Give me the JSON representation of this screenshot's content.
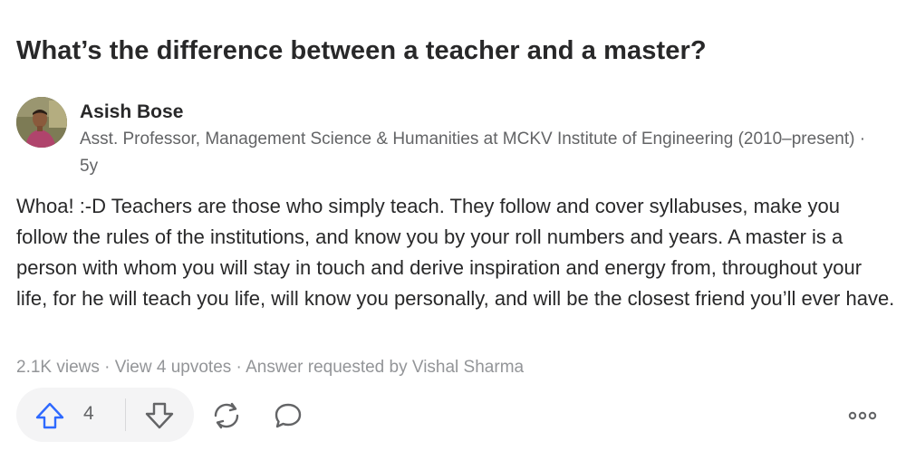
{
  "question": {
    "title": "What’s the difference between a teacher and a master?"
  },
  "author": {
    "name": "Asish Bose",
    "credential": "Asst. Professor, Management Science & Humanities at MCKV Institute of Engineering (2010–present) · 5y"
  },
  "answer": {
    "text": "Whoa! :-D Teachers are those who simply teach. They follow and cover syllabuses, make you follow the rules of the institutions, and know you by your roll numbers and years. A master is a person with whom you will stay in touch and derive inspiration and energy from, throughout your life, for he will teach you life, will know you personally, and will be the closest friend you’ll ever have.",
    "stats": "2.1K views · View 4 upvotes · Answer requested by Vishal Sharma"
  },
  "actions": {
    "upvote_count": "4",
    "upvote_icon": "arrow-up-icon",
    "downvote_icon": "arrow-down-icon",
    "share_icon": "share-icon",
    "comment_icon": "comment-icon",
    "more_icon": "more-icon"
  },
  "colors": {
    "accent": "#2e69ff",
    "text": "#282829",
    "muted": "#636466",
    "light": "#939598"
  }
}
